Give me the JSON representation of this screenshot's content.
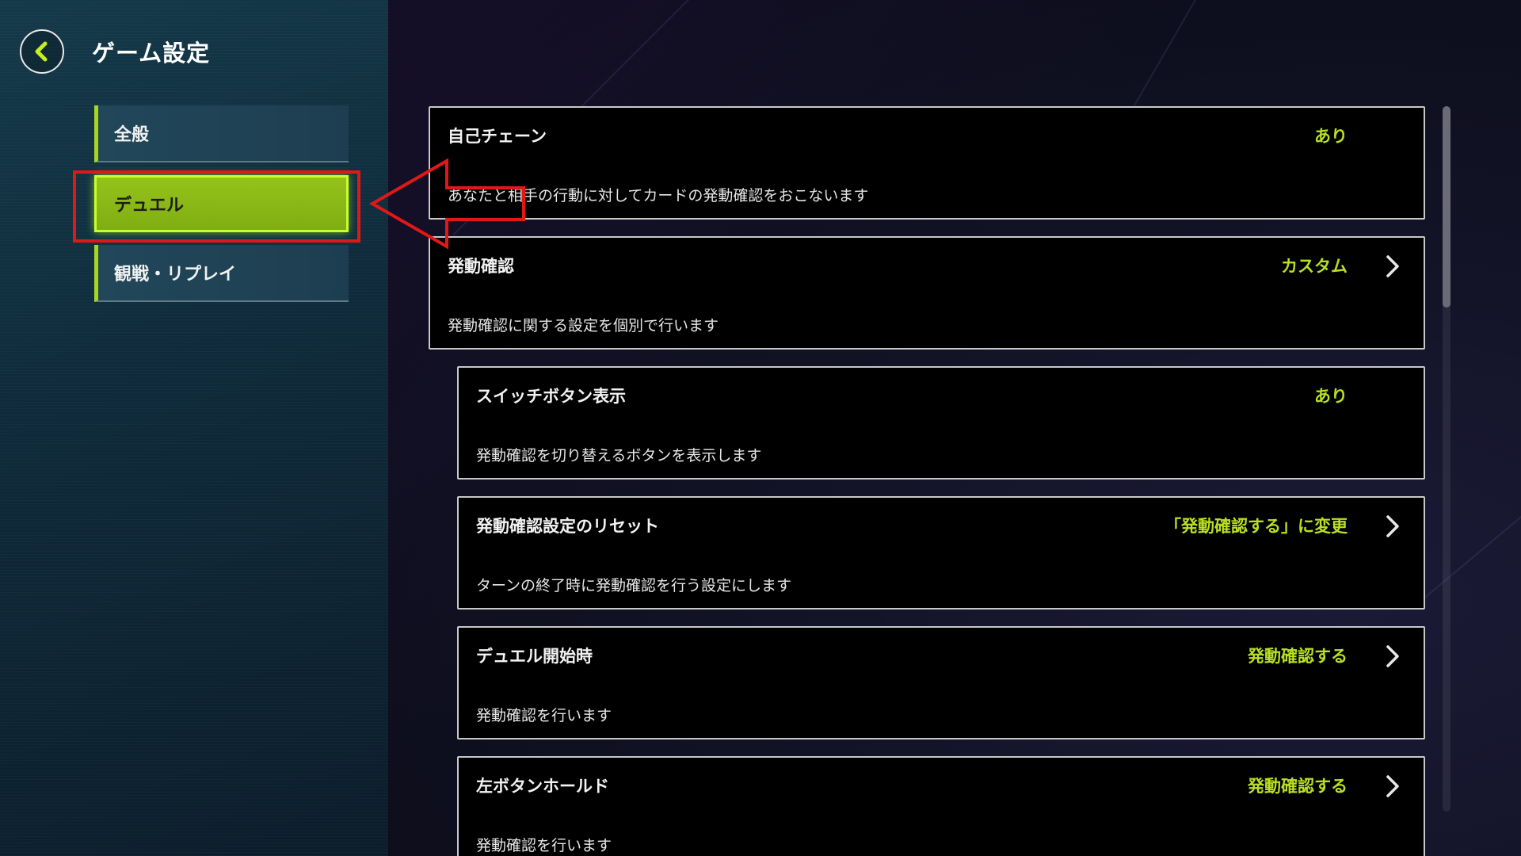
{
  "header": {
    "title": "ゲーム設定"
  },
  "sidebar": {
    "items": [
      {
        "label": "全般"
      },
      {
        "label": "デュエル",
        "active": true
      },
      {
        "label": "観戦・リプレイ"
      }
    ]
  },
  "settings": [
    {
      "title": "自己チェーン",
      "value": "あり",
      "description": "あなたと相手の行動に対してカードの発動確認をおこないます",
      "has_chevron": false
    },
    {
      "title": "発動確認",
      "value": "カスタム",
      "description": "発動確認に関する設定を個別で行います",
      "has_chevron": true
    },
    {
      "title": "スイッチボタン表示",
      "value": "あり",
      "description": "発動確認を切り替えるボタンを表示します",
      "has_chevron": false
    },
    {
      "title": "発動確認設定のリセット",
      "value": "「発動確認する」に変更",
      "description": "ターンの終了時に発動確認を行う設定にします",
      "has_chevron": true
    },
    {
      "title": "デュエル開始時",
      "value": "発動確認する",
      "description": "発動確認を行います",
      "has_chevron": true
    },
    {
      "title": "左ボタンホールド",
      "value": "発動確認する",
      "description": "発動確認を行います",
      "has_chevron": true
    }
  ],
  "colors": {
    "accent": "#b9e021",
    "active_tab": "#8dbb17",
    "highlight_annotation": "#e01818",
    "card_background": "#000000"
  },
  "icons": {
    "back": "chevron-left-icon",
    "card_chevron": "chevron-right-icon",
    "annotation": "arrow-left-outline"
  }
}
